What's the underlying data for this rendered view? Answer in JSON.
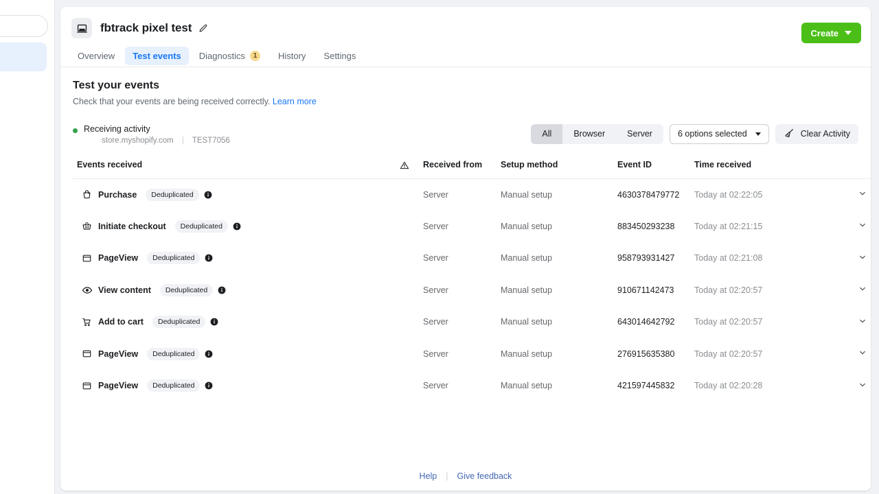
{
  "sidebar": {
    "search_placeholder": "",
    "selected_item": ""
  },
  "header": {
    "app_icon": "monitor-icon",
    "title": "fbtrack pixel test",
    "edit_icon": "pencil-icon",
    "create_label": "Create"
  },
  "tabs": [
    {
      "label": "Overview",
      "active": false,
      "badge": null
    },
    {
      "label": "Test events",
      "active": true,
      "badge": null
    },
    {
      "label": "Diagnostics",
      "active": false,
      "badge": "1"
    },
    {
      "label": "History",
      "active": false,
      "badge": null
    },
    {
      "label": "Settings",
      "active": false,
      "badge": null
    }
  ],
  "page": {
    "title": "Test your events",
    "subtitle": "Check that your events are being received correctly.",
    "learn_more": "Learn more"
  },
  "activity": {
    "status": "Receiving activity",
    "domain": "store.myshopify.com",
    "separator": "|",
    "test_code": "TEST7056"
  },
  "filters": {
    "segments": [
      {
        "label": "All",
        "active": true
      },
      {
        "label": "Browser",
        "active": false
      },
      {
        "label": "Server",
        "active": false
      }
    ],
    "dropdown_label": "6 options selected",
    "clear_label": "Clear Activity",
    "clear_icon": "broom-icon"
  },
  "table": {
    "columns": {
      "events": "Events received",
      "warning_icon": "warning-triangle-icon",
      "received_from": "Received from",
      "setup_method": "Setup method",
      "event_id": "Event ID",
      "time_received": "Time received"
    },
    "rows": [
      {
        "icon": "shopping-bag-icon",
        "event": "Purchase",
        "badge": "Deduplicated",
        "info_icon": "info-icon",
        "received_from": "Server",
        "setup_method": "Manual setup",
        "event_id": "4630378479772",
        "time_received": "Today at 02:22:05",
        "chevron": "chevron-down-icon"
      },
      {
        "icon": "basket-icon",
        "event": "Initiate checkout",
        "badge": "Deduplicated",
        "info_icon": "info-icon",
        "received_from": "Server",
        "setup_method": "Manual setup",
        "event_id": "883450293238",
        "time_received": "Today at 02:21:15",
        "chevron": "chevron-down-icon"
      },
      {
        "icon": "browser-icon",
        "event": "PageView",
        "badge": "Deduplicated",
        "info_icon": "info-icon",
        "received_from": "Server",
        "setup_method": "Manual setup",
        "event_id": "958793931427",
        "time_received": "Today at 02:21:08",
        "chevron": "chevron-down-icon"
      },
      {
        "icon": "eye-icon",
        "event": "View content",
        "badge": "Deduplicated",
        "info_icon": "info-icon",
        "received_from": "Server",
        "setup_method": "Manual setup",
        "event_id": "910671142473",
        "time_received": "Today at 02:20:57",
        "chevron": "chevron-down-icon"
      },
      {
        "icon": "cart-icon",
        "event": "Add to cart",
        "badge": "Deduplicated",
        "info_icon": "info-icon",
        "received_from": "Server",
        "setup_method": "Manual setup",
        "event_id": "643014642792",
        "time_received": "Today at 02:20:57",
        "chevron": "chevron-down-icon"
      },
      {
        "icon": "browser-icon",
        "event": "PageView",
        "badge": "Deduplicated",
        "info_icon": "info-icon",
        "received_from": "Server",
        "setup_method": "Manual setup",
        "event_id": "276915635380",
        "time_received": "Today at 02:20:57",
        "chevron": "chevron-down-icon"
      },
      {
        "icon": "browser-icon",
        "event": "PageView",
        "badge": "Deduplicated",
        "info_icon": "info-icon",
        "received_from": "Server",
        "setup_method": "Manual setup",
        "event_id": "421597445832",
        "time_received": "Today at 02:20:28",
        "chevron": "chevron-down-icon"
      }
    ]
  },
  "footer": {
    "help": "Help",
    "separator": "|",
    "feedback": "Give feedback"
  },
  "colors": {
    "accent_blue": "#1877f2",
    "create_green": "#4bbf17",
    "status_green": "#31a24c",
    "badge_yellow": "#f7d88c",
    "link_blue": "#4267b2"
  }
}
